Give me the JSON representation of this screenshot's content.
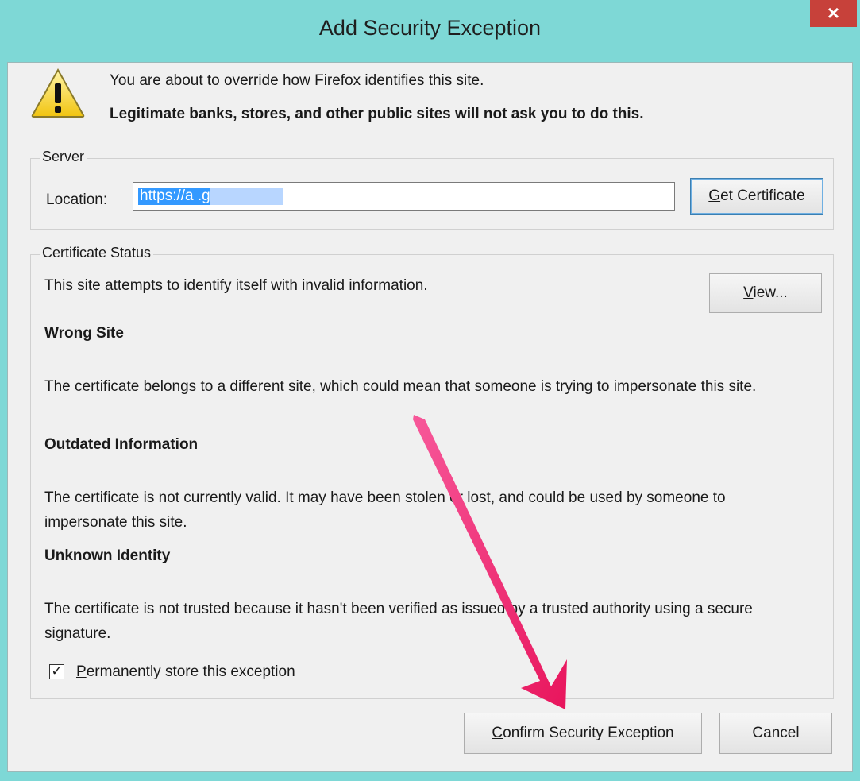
{
  "window": {
    "title": "Add Security Exception",
    "close_glyph": "×"
  },
  "intro": {
    "line1": "You are about to override how Firefox identifies this site.",
    "line2": "Legitimate banks, stores, and other public sites will not ask you to do this.",
    "icon": "warning-icon"
  },
  "server": {
    "legend": "Server",
    "location_label": "Location:",
    "location_value": "https://a          .gr/",
    "get_certificate_key": "G",
    "get_certificate_rest": "et Certificate"
  },
  "status": {
    "legend": "Certificate Status",
    "intro": "This site attempts to identify itself with invalid information.",
    "view_key": "V",
    "view_rest": "iew...",
    "sections": [
      {
        "title": "Wrong Site",
        "text": "The certificate belongs to a different site, which could mean that someone is trying to impersonate this site."
      },
      {
        "title": "Outdated Information",
        "text": "The certificate is not currently valid. It may have been stolen or lost, and could be used by someone to impersonate this site."
      },
      {
        "title": "Unknown Identity",
        "text": "The certificate is not trusted because it hasn't been verified as issued by a trusted authority using a secure signature."
      }
    ],
    "store_checked": true,
    "store_key": "P",
    "store_rest": "ermanently store this exception"
  },
  "buttons": {
    "confirm_key": "C",
    "confirm_rest": "onfirm Security Exception",
    "cancel": "Cancel"
  },
  "colors": {
    "titlebar": "#7ed8d6",
    "close": "#c7413a",
    "annotation_arrow": "#f0306a",
    "selection": "#3399ff"
  }
}
